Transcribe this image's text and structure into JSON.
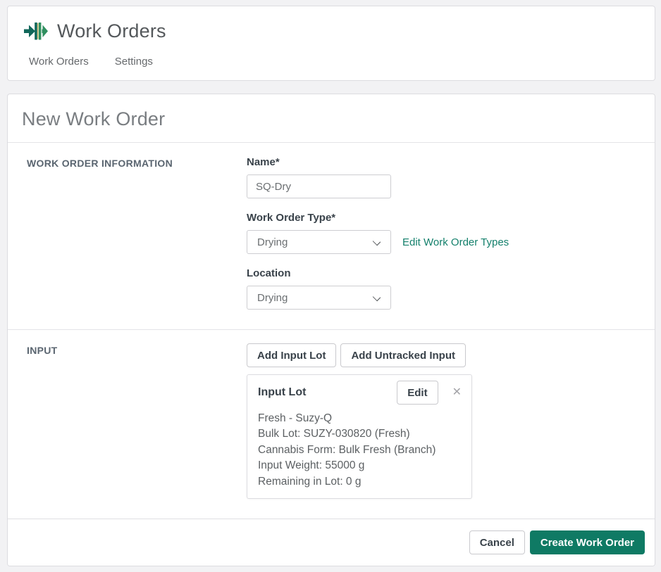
{
  "header": {
    "app_title": "Work Orders",
    "logo_icon": "merge-arrows-icon",
    "nav": [
      {
        "label": "Work Orders"
      },
      {
        "label": "Settings"
      }
    ]
  },
  "page": {
    "title": "New Work Order"
  },
  "work_order_information": {
    "section_label": "WORK ORDER INFORMATION",
    "name_label": "Name*",
    "name_value": "SQ-Dry",
    "type_label": "Work Order Type*",
    "type_value": "Drying",
    "type_edit_link": "Edit Work Order Types",
    "location_label": "Location",
    "location_value": "Drying"
  },
  "input_section": {
    "section_label": "INPUT",
    "add_input_lot_button": "Add Input Lot",
    "add_untracked_button": "Add Untracked Input",
    "lot_card": {
      "title": "Input Lot",
      "edit_button": "Edit",
      "close_glyph": "✕",
      "lines": [
        "Fresh - Suzy-Q",
        "Bulk Lot: SUZY-030820 (Fresh)",
        "Cannabis Form: Bulk Fresh (Branch)",
        "Input Weight: 55000 g",
        "Remaining in Lot: 0 g"
      ]
    }
  },
  "footer": {
    "cancel_button": "Cancel",
    "submit_button": "Create Work Order"
  },
  "colors": {
    "brand_green": "#0f7a64",
    "brand_green_dark": "#11675a",
    "brand_green_light": "#2f8f5f",
    "link_teal": "#14806c",
    "gold_accent": "#c9a43c"
  }
}
